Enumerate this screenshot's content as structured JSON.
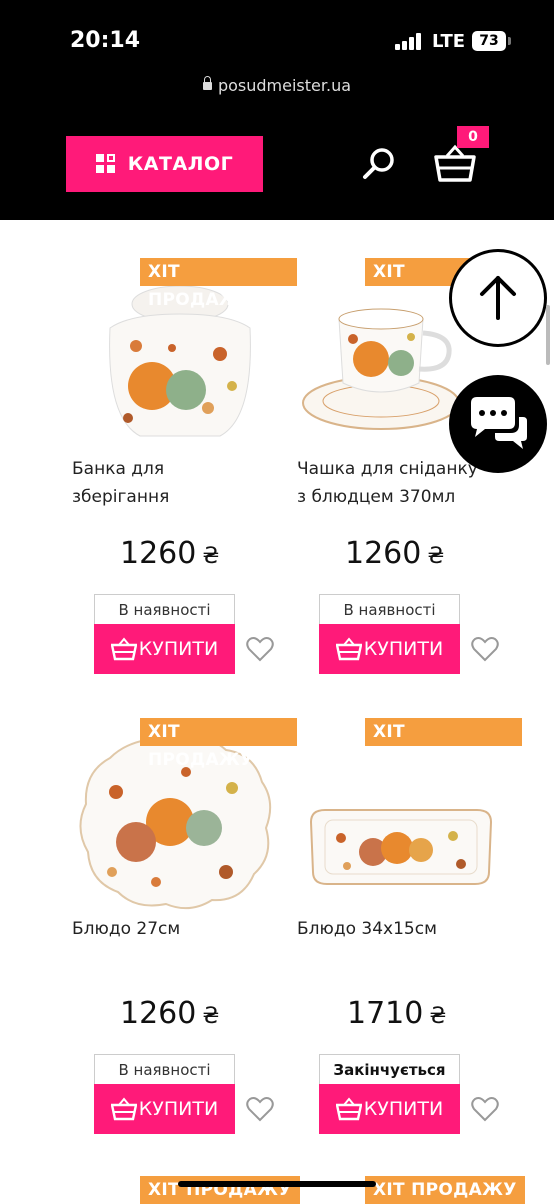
{
  "status": {
    "time": "20:14",
    "network": "LTE",
    "battery": "73"
  },
  "browser": {
    "url": "posudmeister.ua"
  },
  "header": {
    "catalog_label": "КАТАЛОГ",
    "cart_count": "0"
  },
  "accent_color": "#ff1a79",
  "badge_color": "#f59e3f",
  "products": [
    {
      "badge": "ХІТ ПРОДАЖУ",
      "title_line1": "Банка для",
      "title_line2": "зберігання",
      "price": "1260",
      "currency": "₴",
      "stock": "В наявності",
      "buy_label": "КУПИТИ"
    },
    {
      "badge": "ХІТ ПРОДАЖУ",
      "title_line1": "Чашка для сніданку",
      "title_line2": "з блюдцем 370мл",
      "price": "1260",
      "currency": "₴",
      "stock": "В наявності",
      "buy_label": "КУПИТИ"
    },
    {
      "badge": "ХІТ ПРОДАЖУ",
      "title_line1": "Блюдо 27см",
      "title_line2": "",
      "price": "1260",
      "currency": "₴",
      "stock": "В наявності",
      "buy_label": "КУПИТИ"
    },
    {
      "badge": "ХІТ ПРОДАЖУ",
      "title_line1": "Блюдо 34х15см",
      "title_line2": "",
      "price": "1710",
      "currency": "₴",
      "stock": "Закінчується",
      "buy_label": "КУПИТИ"
    },
    {
      "badge": "ХІТ ПРОДАЖУ"
    },
    {
      "badge": "ХІТ ПРОДАЖУ"
    }
  ],
  "icons": [
    "lock-icon",
    "grid-icon",
    "search-icon",
    "basket-icon",
    "heart-icon",
    "arrow-up-icon",
    "chat-icon",
    "cart-icon"
  ]
}
